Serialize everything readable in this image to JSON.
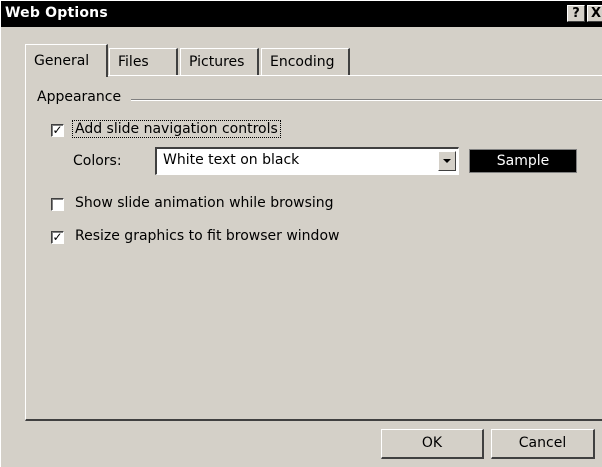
{
  "window": {
    "title": "Web Options",
    "help_button": "?",
    "close_button": "X"
  },
  "tabs": [
    {
      "label": "General",
      "active": true
    },
    {
      "label": "Files",
      "active": false
    },
    {
      "label": "Pictures",
      "active": false
    },
    {
      "label": "Encoding",
      "active": false
    }
  ],
  "general": {
    "group_label": "Appearance",
    "nav_controls": {
      "label": "Add slide navigation controls",
      "checked": true
    },
    "colors": {
      "label": "Colors:",
      "value": "White text on black"
    },
    "sample_label": "Sample",
    "animation": {
      "label": "Show slide animation while browsing",
      "checked": false
    },
    "resize": {
      "label": "Resize graphics to fit browser window",
      "checked": true
    }
  },
  "buttons": {
    "ok": "OK",
    "cancel": "Cancel"
  },
  "colors": {
    "face": "#d4d0c8",
    "titlebar": "#000000",
    "sample_bg": "#000000",
    "sample_fg": "#ffffff"
  }
}
